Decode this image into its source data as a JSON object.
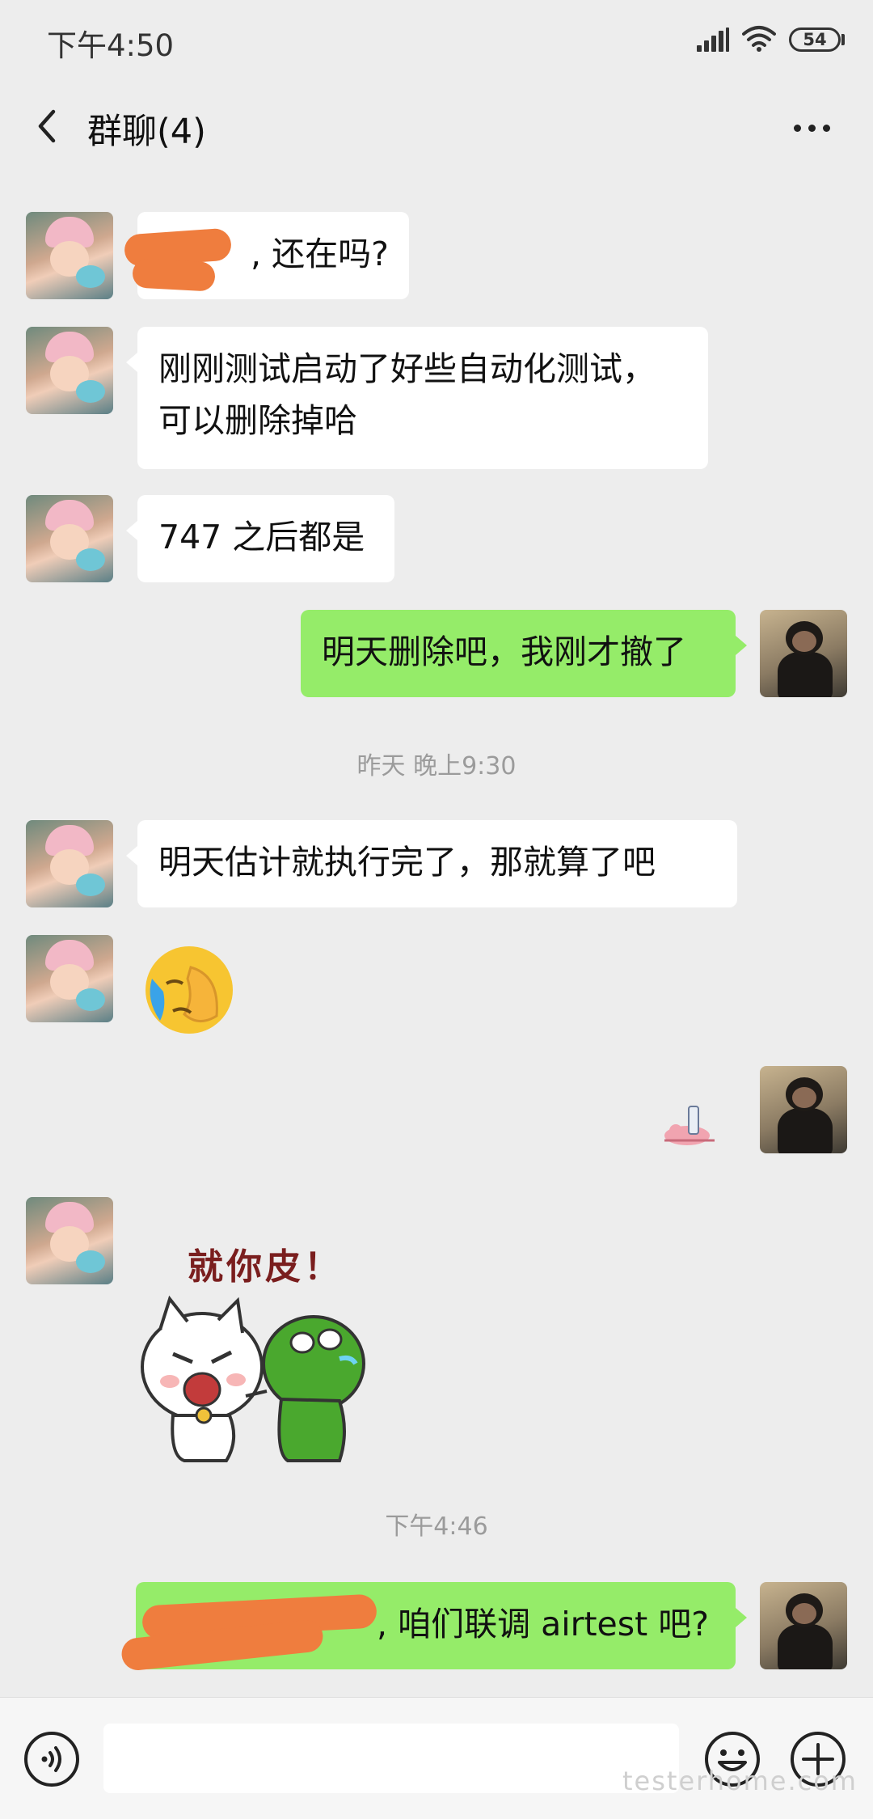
{
  "status_bar": {
    "time": "下午4:50",
    "battery": "54"
  },
  "header": {
    "title": "群聊(4)"
  },
  "messages": [
    {
      "side": "in",
      "text": ", 还在吗?"
    },
    {
      "side": "in",
      "text_line1": "刚刚测试启动了好些自动化测试，",
      "text_line2": "可以删除掉哈"
    },
    {
      "side": "in",
      "text": "747 之后都是"
    },
    {
      "side": "out",
      "text": "明天删除吧，我刚才撤了"
    },
    {
      "side": "in",
      "text": "明天估计就执行完了，那就算了吧"
    },
    {
      "side": "in",
      "emoji": "facepalm-crying-emoji"
    },
    {
      "side": "out",
      "emoji": "small-sticker"
    },
    {
      "side": "in",
      "sticker_caption": "就你皮！"
    },
    {
      "side": "out",
      "text": ", 咱们联调 airtest 吧?"
    }
  ],
  "timestamps": {
    "t1": "昨天 晚上9:30",
    "t2": "下午4:46"
  },
  "colors": {
    "incoming_bubble": "#ffffff",
    "outgoing_bubble": "#95ec69",
    "background": "#ededed",
    "redaction": "#ef7d3e"
  },
  "watermark": "testerhome.com"
}
